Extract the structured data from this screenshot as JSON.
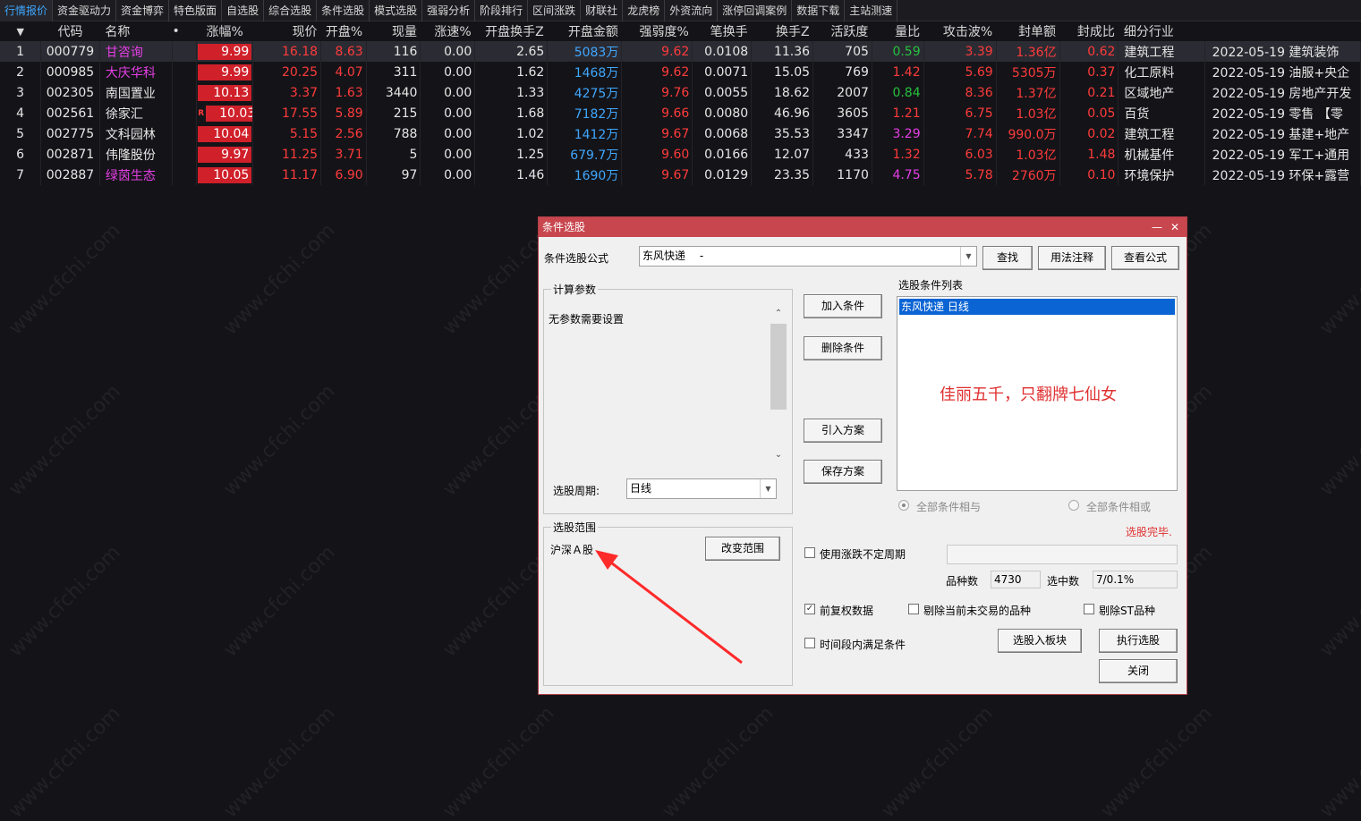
{
  "tabs": [
    "行情报价",
    "资金驱动力",
    "资金博弈",
    "特色版面",
    "自选股",
    "综合选股",
    "条件选股",
    "模式选股",
    "强弱分析",
    "阶段排行",
    "区间涨跌",
    "财联社",
    "龙虎榜",
    "外资流向",
    "涨停回调案例",
    "数据下载",
    "主站测速"
  ],
  "table": {
    "headers": [
      "代码",
      "名称",
      "•",
      "涨幅%",
      "现价",
      "开盘%",
      "现量",
      "涨速%",
      "开盘换手Z",
      "开盘金额",
      "强弱度%",
      "笔换手",
      "换手Z",
      "活跃度",
      "量比",
      "攻击波%",
      "封单额",
      "封成比",
      "细分行业"
    ],
    "rows": [
      {
        "idx": "1",
        "code": "000779",
        "name": "甘咨询",
        "chg": "9.99",
        "price": "16.18",
        "open": "8.63",
        "vol": "116",
        "speed": "0.00",
        "open_turn": "2.65",
        "open_amt": "5083万",
        "strength": "9.62",
        "pen_turn": "0.0108",
        "turn": "11.36",
        "active": "705",
        "vol_ratio": "0.59",
        "attack": "3.39",
        "seal_amt": "1.36亿",
        "seal_ratio": "0.62",
        "industry": "建筑工程",
        "note": "2022-05-19 建筑装饰"
      },
      {
        "idx": "2",
        "code": "000985",
        "name": "大庆华科",
        "chg": "9.99",
        "price": "20.25",
        "open": "4.07",
        "vol": "311",
        "speed": "0.00",
        "open_turn": "1.62",
        "open_amt": "1468万",
        "strength": "9.62",
        "pen_turn": "0.0071",
        "turn": "15.05",
        "active": "769",
        "vol_ratio": "1.42",
        "attack": "5.69",
        "seal_amt": "5305万",
        "seal_ratio": "0.37",
        "industry": "化工原料",
        "note": "2022-05-19 油服+央企"
      },
      {
        "idx": "3",
        "code": "002305",
        "name": "南国置业",
        "chg": "10.13",
        "price": "3.37",
        "open": "1.63",
        "vol": "3440",
        "speed": "0.00",
        "open_turn": "1.33",
        "open_amt": "4275万",
        "strength": "9.76",
        "pen_turn": "0.0055",
        "turn": "18.62",
        "active": "2007",
        "vol_ratio": "0.84",
        "attack": "8.36",
        "seal_amt": "1.37亿",
        "seal_ratio": "0.21",
        "industry": "区域地产",
        "note": "2022-05-19 房地产开发"
      },
      {
        "idx": "4",
        "code": "002561",
        "name": "徐家汇",
        "chg": "10.03",
        "price": "17.55",
        "open": "5.89",
        "vol": "215",
        "speed": "0.00",
        "open_turn": "1.68",
        "open_amt": "7182万",
        "strength": "9.66",
        "pen_turn": "0.0080",
        "turn": "46.96",
        "active": "3605",
        "vol_ratio": "1.21",
        "attack": "6.75",
        "seal_amt": "1.03亿",
        "seal_ratio": "0.05",
        "industry": "百货",
        "note": "2022-05-19 零售 【零"
      },
      {
        "idx": "5",
        "code": "002775",
        "name": "文科园林",
        "chg": "10.04",
        "price": "5.15",
        "open": "2.56",
        "vol": "788",
        "speed": "0.00",
        "open_turn": "1.02",
        "open_amt": "1412万",
        "strength": "9.67",
        "pen_turn": "0.0068",
        "turn": "35.53",
        "active": "3347",
        "vol_ratio": "3.29",
        "attack": "7.74",
        "seal_amt": "990.0万",
        "seal_ratio": "0.02",
        "industry": "建筑工程",
        "note": "2022-05-19 基建+地产"
      },
      {
        "idx": "6",
        "code": "002871",
        "name": "伟隆股份",
        "chg": "9.97",
        "price": "11.25",
        "open": "3.71",
        "vol": "5",
        "speed": "0.00",
        "open_turn": "1.25",
        "open_amt": "679.7万",
        "strength": "9.60",
        "pen_turn": "0.0166",
        "turn": "12.07",
        "active": "433",
        "vol_ratio": "1.32",
        "attack": "6.03",
        "seal_amt": "1.03亿",
        "seal_ratio": "1.48",
        "industry": "机械基件",
        "note": "2022-05-19 军工+通用"
      },
      {
        "idx": "7",
        "code": "002887",
        "name": "绿茵生态",
        "chg": "10.05",
        "price": "11.17",
        "open": "6.90",
        "vol": "97",
        "speed": "0.00",
        "open_turn": "1.46",
        "open_amt": "1690万",
        "strength": "9.67",
        "pen_turn": "0.0129",
        "turn": "23.35",
        "active": "1170",
        "vol_ratio": "4.75",
        "attack": "5.78",
        "seal_amt": "2760万",
        "seal_ratio": "0.10",
        "industry": "环境保护",
        "note": "2022-05-19 环保+露营"
      }
    ]
  },
  "watermark": "www.cfchi.com",
  "dialog": {
    "title": "条件选股",
    "formula_label": "条件选股公式",
    "formula_value": "东风快递　 -",
    "find_btn": "查找",
    "usage_btn": "用法注释",
    "view_btn": "查看公式",
    "params_group": "计算参数",
    "params_text": "无参数需要设置",
    "period_label": "选股周期:",
    "period_value": "日线",
    "add_btn": "加入条件",
    "del_btn": "删除条件",
    "import_btn": "引入方案",
    "save_btn": "保存方案",
    "cond_list_label": "选股条件列表",
    "cond_item": "东风快递  日线",
    "promo_text": "佳丽五千，只翻牌七仙女",
    "all_and": "全部条件相与",
    "all_or": "全部条件相或",
    "status": "选股完毕.",
    "range_group": "选股范围",
    "range_value": "沪深Ａ股",
    "change_range_btn": "改变范围",
    "use_period_label": "使用涨跌不定周期",
    "count_label": "品种数",
    "count_value": "4730",
    "selected_label": "选中数",
    "selected_value": "7/0.1%",
    "forward_adj_label": "前复权数据",
    "exclude_untraded_label": "剔除当前未交易的品种",
    "exclude_st_label": "剔除ST品种",
    "time_cond_label": "时间段内满足条件",
    "to_block_btn": "选股入板块",
    "run_btn": "执行选股",
    "close_btn": "关闭"
  }
}
